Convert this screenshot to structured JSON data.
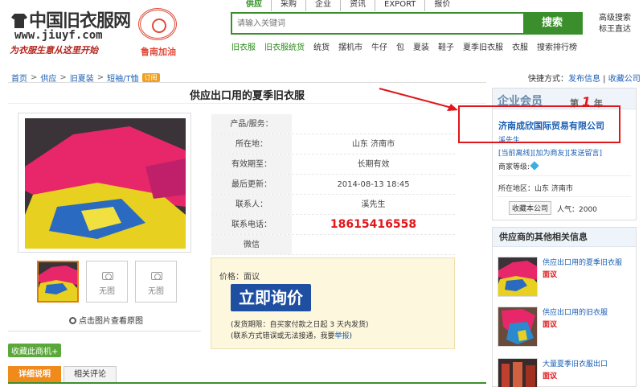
{
  "logo": {
    "brand": "中国旧衣服网",
    "domain": "www.jiuyf.com",
    "tagline": "为衣服生意从这里开始",
    "slogan": "鲁南加油"
  },
  "topnav": [
    "供应",
    "采购",
    "企业",
    "资讯",
    "EXPORT",
    "报价"
  ],
  "search": {
    "placeholder": "请输入关键词",
    "button": "搜索",
    "advanced": "高级搜索",
    "tag": "标王直达"
  },
  "categories": [
    "旧衣服",
    "旧衣服统货",
    "统货",
    "摆机市",
    "牛仔",
    "包",
    "夏装",
    "鞋子",
    "夏季旧衣服",
    "衣服",
    "搜索排行榜"
  ],
  "breadcrumb": {
    "items": [
      "首页",
      "供应",
      "旧夏装",
      "短袖/T恤"
    ],
    "tag": "订阅"
  },
  "shortcut": {
    "label": "快捷方式：",
    "publish": "发布信息",
    "favorite": "收藏公司"
  },
  "product": {
    "title": "供应出口用的夏季旧衣服",
    "no_image": "无图",
    "zoom": "点击图片查看原图",
    "collect": "收藏此商机+"
  },
  "info_rows": [
    {
      "k": "产品/服务：",
      "v": ""
    },
    {
      "k": "所在地：",
      "v": "山东 济南市"
    },
    {
      "k": "有效期至：",
      "v": "长期有效"
    },
    {
      "k": "最后更新：",
      "v": "2014-08-13 18:45"
    },
    {
      "k": "联系人：",
      "v": "溪先生"
    },
    {
      "k": "联系电话：",
      "v": "18615416558"
    },
    {
      "k": "微信",
      "v": ""
    }
  ],
  "price": {
    "label": "价格：面议",
    "ask": "立即询价",
    "note1": "(发货期限：自买家付款之日起  3 天内发货)",
    "note2_pre": "(联系方式错误或无法接通，我要",
    "note2_link": "举报",
    "note2_post": ")"
  },
  "tabs": [
    "详细说明",
    "相关评论"
  ],
  "member": {
    "title": "企业会员",
    "year_pre": "第",
    "year_num": "1",
    "year_post": "年",
    "company": "济南成欣国际贸易有限公司",
    "person": "溪先生",
    "actions": "[当前离线][加为商友][发送留言]",
    "level": "商家等级:",
    "region": "所在地区：山东 济南市",
    "fav_button": "收藏本公司",
    "popularity": "人气：2000"
  },
  "other": {
    "title": "供应商的其他相关信息",
    "items": [
      {
        "name": "供应出口用的夏季旧衣服",
        "price": "面议"
      },
      {
        "name": "供应出口用的旧衣服",
        "price": "面议"
      },
      {
        "name": "大量夏季旧衣服出口",
        "price": "面议"
      }
    ]
  },
  "colors": {
    "brand_green": "#3a8f2c",
    "ask_blue": "#1e4fa0",
    "phone_red": "#e0161a",
    "tab_orange": "#f08a1a"
  }
}
